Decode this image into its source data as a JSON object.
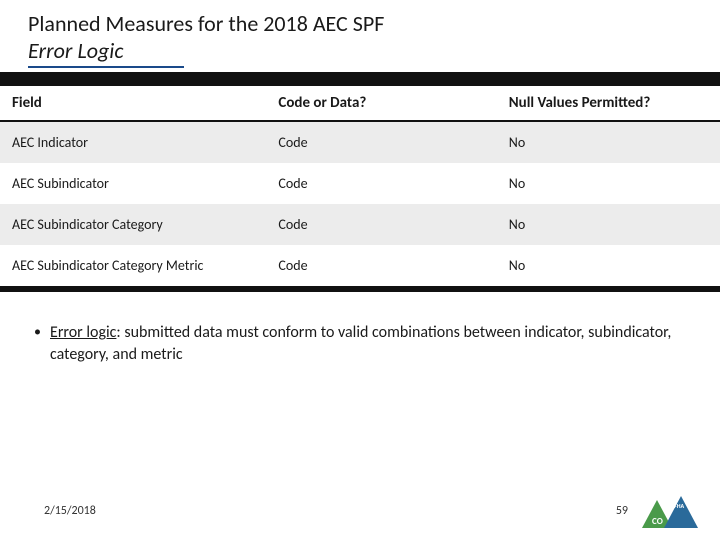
{
  "header": {
    "title_line1": "Planned Measures for the 2018 AEC SPF",
    "title_line2": "Error Logic"
  },
  "table": {
    "headers": {
      "field": "Field",
      "code_or_data": "Code or Data?",
      "null_permitted": "Null Values Permitted?"
    },
    "rows": [
      {
        "field": "AEC Indicator",
        "code_or_data": "Code",
        "null_permitted": "No"
      },
      {
        "field": "AEC Subindicator",
        "code_or_data": "Code",
        "null_permitted": "No"
      },
      {
        "field": "AEC Subindicator Category",
        "code_or_data": "Code",
        "null_permitted": "No"
      },
      {
        "field": "AEC Subindicator Category Metric",
        "code_or_data": "Code",
        "null_permitted": "No"
      }
    ]
  },
  "bullet": {
    "lead": "Error logic",
    "rest": ": submitted data must conform to valid combinations between indicator, subindicator, category, and metric"
  },
  "footer": {
    "date": "2/15/2018",
    "page": "59"
  },
  "logo": {
    "left_text": "CO",
    "right_text_top": "FHA",
    "colors": {
      "left_triangle": "#4a9a4a",
      "right_triangle": "#2a6a9a"
    }
  }
}
